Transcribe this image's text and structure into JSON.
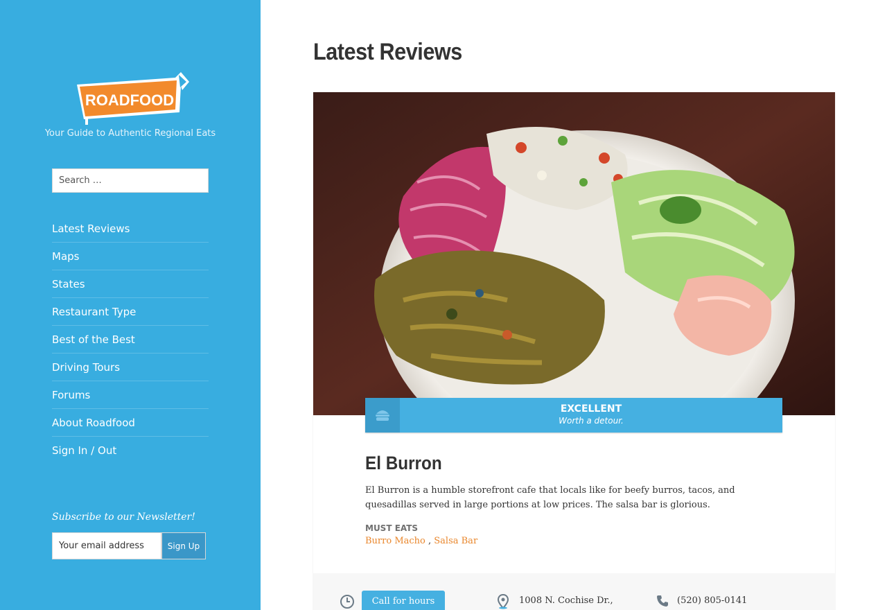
{
  "sidebar": {
    "logo_text": "ROADFOOD",
    "tagline": "Your Guide to Authentic Regional Eats",
    "search": {
      "placeholder": "Search …"
    },
    "nav": [
      "Latest Reviews",
      "Maps",
      "States",
      "Restaurant Type",
      "Best of the Best",
      "Driving Tours",
      "Forums",
      "About Roadfood",
      "Sign In / Out"
    ],
    "newsletter": {
      "title": "Subscribe to our Newsletter!",
      "email_placeholder": "Your email address",
      "button": "Sign Up"
    }
  },
  "main": {
    "title": "Latest Reviews",
    "review": {
      "rating": {
        "level": "EXCELLENT",
        "description": "Worth a detour.",
        "icon": "burger-icon"
      },
      "name": "El Burron",
      "description": "El Burron is a humble storefront cafe that locals like for beefy burros, tacos, and quesadillas served in large portions at low prices. The salsa bar is glorious.",
      "must_eats_label": "MUST EATS",
      "must_eats": [
        "Burro Macho",
        "Salsa Bar"
      ],
      "must_eats_separator": " , ",
      "hours_button": "Call for hours",
      "address": "1008 N. Cochise Dr.,",
      "phone": "(520) 805-0141"
    }
  },
  "colors": {
    "sidebar_bg": "#38ade0",
    "accent_orange": "#e9862b",
    "rating_blue": "#45b0e1"
  }
}
